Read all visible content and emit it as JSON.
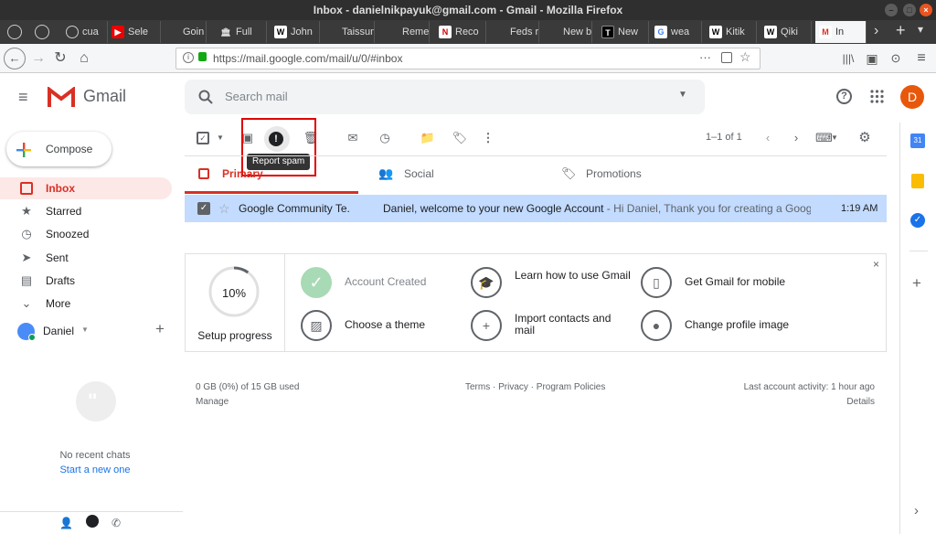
{
  "window": {
    "title": "Inbox - danielnikpayuk@gmail.com - Gmail - Mozilla Firefox"
  },
  "tabs": [
    {
      "label": "cua",
      "fav": "globe-icon"
    },
    {
      "label": "Sele",
      "fav": "youtube-icon"
    },
    {
      "label": "Goin",
      "fav": ""
    },
    {
      "label": "Full",
      "fav": "museum-icon"
    },
    {
      "label": "John",
      "fav": "wikipedia-icon"
    },
    {
      "label": "Taissum",
      "fav": ""
    },
    {
      "label": "Rememi",
      "fav": ""
    },
    {
      "label": "Reco",
      "fav": "news-icon"
    },
    {
      "label": "Feds re",
      "fav": ""
    },
    {
      "label": "New bo",
      "fav": ""
    },
    {
      "label": "New",
      "fav": "nytimes-icon"
    },
    {
      "label": "wea",
      "fav": "google-icon"
    },
    {
      "label": "Kitik",
      "fav": "wikipedia-icon"
    },
    {
      "label": "Qiki",
      "fav": "wikipedia-icon"
    },
    {
      "label": "In",
      "fav": "gmail-icon"
    }
  ],
  "nav": {
    "url": "https://mail.google.com/mail/u/0/#inbox"
  },
  "gmail": {
    "brand": "Gmail",
    "search_placeholder": "Search mail",
    "avatar_letter": "D",
    "compose": "Compose",
    "folders": [
      {
        "label": "Inbox",
        "icon": "inbox-icon"
      },
      {
        "label": "Starred",
        "icon": "star-icon"
      },
      {
        "label": "Snoozed",
        "icon": "clock-icon"
      },
      {
        "label": "Sent",
        "icon": "send-icon"
      },
      {
        "label": "Drafts",
        "icon": "draft-icon"
      },
      {
        "label": "More",
        "icon": "chevron-down-icon"
      }
    ],
    "hangouts_user": "Daniel",
    "no_chats": "No recent chats",
    "start_chat": "Start a new one",
    "pagination": "1–1 of 1",
    "tooltip": "Report spam",
    "categories": [
      "Primary",
      "Social",
      "Promotions"
    ],
    "email": {
      "sender": "Google Community Te.",
      "subject": "Daniel, welcome to your new Google Account",
      "snippet": " - Hi Daniel, Thank you for creating a Google A...",
      "time": "1:19 AM"
    },
    "setup": {
      "progress": "10%",
      "progress_value": 0.1,
      "progress_label": "Setup progress",
      "items": [
        {
          "label": "Account Created",
          "done": true,
          "icon": "check-icon"
        },
        {
          "label": "Learn how to use Gmail",
          "done": false,
          "icon": "graduation-cap-icon"
        },
        {
          "label": "Get Gmail for mobile",
          "done": false,
          "icon": "phone-icon"
        },
        {
          "label": "Choose a theme",
          "done": false,
          "icon": "image-icon"
        },
        {
          "label": "Import contacts and mail",
          "done": false,
          "icon": "add-person-icon"
        },
        {
          "label": "Change profile image",
          "done": false,
          "icon": "account-icon"
        }
      ]
    },
    "footer": {
      "storage": "0 GB (0%) of 15 GB used",
      "manage": "Manage",
      "links": "Terms · Privacy · Program Policies",
      "activity": "Last account activity: 1 hour ago",
      "details": "Details"
    }
  },
  "colors": {
    "gmail_red": "#d93025",
    "selected_row": "#c2dbff",
    "highlight_box": "#e00000",
    "link": "#1a73e8"
  }
}
